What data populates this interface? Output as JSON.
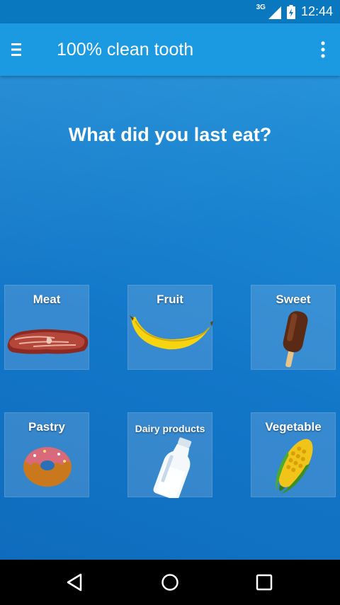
{
  "status_bar": {
    "network_type": "3G",
    "time": "12:44"
  },
  "app_bar": {
    "title": "100% clean tooth",
    "menu_icon": "hamburger-menu-icon",
    "overflow_icon": "more-vert-icon"
  },
  "question": "What did you last eat?",
  "categories": [
    {
      "label": "Meat",
      "icon": "steak-icon"
    },
    {
      "label": "Fruit",
      "icon": "banana-icon"
    },
    {
      "label": "Sweet",
      "icon": "ice-cream-bar-icon"
    },
    {
      "label": "Pastry",
      "icon": "donut-icon"
    },
    {
      "label": "Dairy products",
      "icon": "milk-bottle-icon"
    },
    {
      "label": "Vegetable",
      "icon": "corn-icon"
    }
  ],
  "nav_bar": {
    "back_icon": "back-triangle-icon",
    "home_icon": "home-circle-icon",
    "recents_icon": "recents-square-icon"
  }
}
